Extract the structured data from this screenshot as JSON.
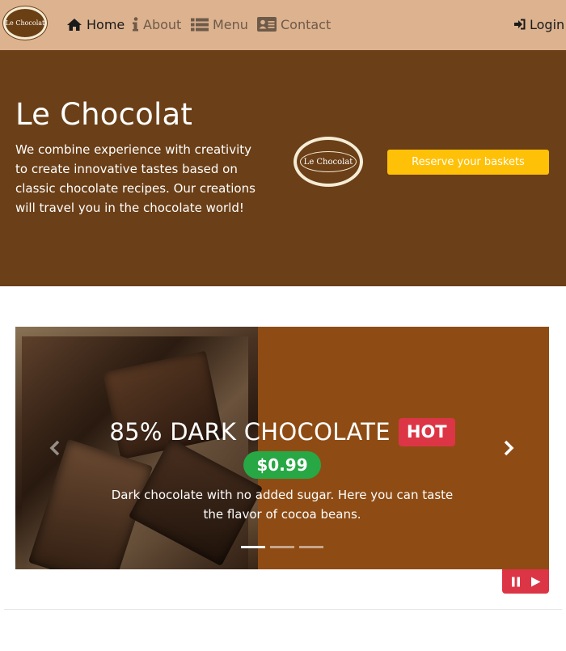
{
  "navbar": {
    "logo_text": "Le Chocolat",
    "items": [
      {
        "label": "Home",
        "icon": "home-icon"
      },
      {
        "label": "About",
        "icon": "info-icon"
      },
      {
        "label": "Menu",
        "icon": "list-icon"
      },
      {
        "label": "Contact",
        "icon": "address-card-icon"
      }
    ],
    "login_label": "Login",
    "login_icon": "sign-in-icon",
    "colors": {
      "background": "#dcb28f",
      "active": "#1a1a1a",
      "inactive": "#6e5a48"
    }
  },
  "hero": {
    "title": "Le Chocolat",
    "description": "We combine experience with creativity to create innovative tastes based on classic chocolate recipes. Our creations will travel you in the chocolate world!",
    "logo_text": "Le Chocolat",
    "reserve_label": "Reserve your baskets",
    "colors": {
      "background": "#6b3f17",
      "button": "#ffc107"
    }
  },
  "carousel": {
    "slide": {
      "title": "85% DARK CHOCOLATE",
      "badge": "HOT",
      "price": "$0.99",
      "description": "Dark chocolate with no added sugar. Here you can taste the flavor of cocoa beans."
    },
    "indicator_count": 3,
    "active_indicator": 0,
    "controls": [
      "pause-icon",
      "play-icon"
    ],
    "colors": {
      "background": "#8e4c14",
      "badge": "#dc3545",
      "price": "#28a745",
      "controls": "#dc3545"
    }
  }
}
